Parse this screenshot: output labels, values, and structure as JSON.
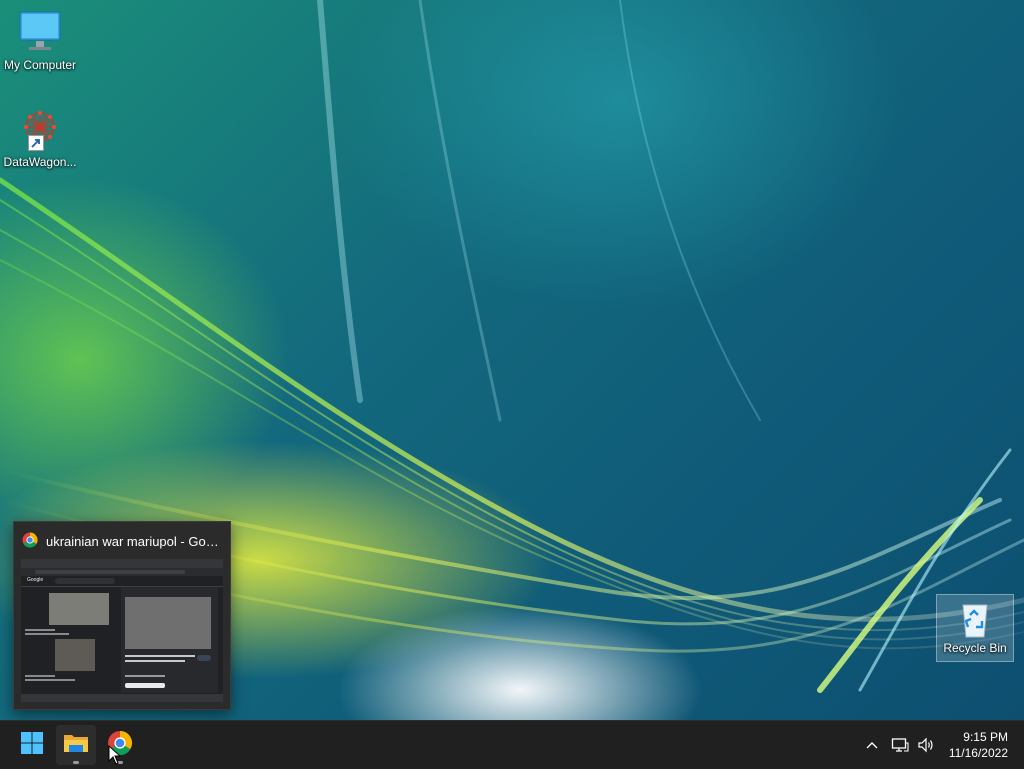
{
  "desktop": {
    "icons": [
      {
        "label": "My Computer",
        "icon": "monitor-icon"
      },
      {
        "label": "DataWagon...",
        "icon": "datawagon-network-icon",
        "shortcut": true
      },
      {
        "label": "Recycle Bin",
        "icon": "recycle-bin-icon"
      }
    ]
  },
  "taskbar": {
    "pinned": [
      {
        "name": "start",
        "icon": "windows-start-icon"
      },
      {
        "name": "file-explorer",
        "icon": "folder-icon",
        "active": true
      },
      {
        "name": "chrome",
        "icon": "chrome-icon",
        "running": true
      }
    ],
    "tray": {
      "overflow_icon": "chevron-up-icon",
      "network_icon": "network-icon",
      "volume_icon": "speaker-icon"
    },
    "clock": {
      "time": "9:15 PM",
      "date": "11/16/2022"
    }
  },
  "preview": {
    "title": "ukrainian war mariupol - Google Search - Google Chrome",
    "icon": "chrome-icon",
    "thumbnail": {
      "search_engine": "Google"
    }
  },
  "colors": {
    "taskbar_bg": "#202020",
    "accent_blue": "#1e90ff",
    "folder_yellow": "#f2c037"
  }
}
